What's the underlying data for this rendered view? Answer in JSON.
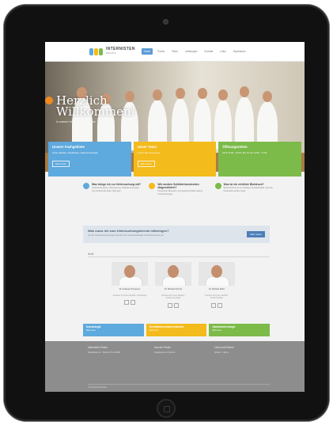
{
  "colors": {
    "box_blue": "#5ea9dd",
    "box_yellow": "#f3bb1c",
    "box_green": "#7cba4a",
    "nav_active": "#5b9bd5",
    "footer": "#8d8d8d"
  },
  "nav": {
    "logo": "INTERNISTEN",
    "logo_sub": "PRAXIS",
    "items": [
      "Home",
      "Praxis",
      "Team",
      "Leistungen",
      "Kontakt",
      "Links",
      "Impressum"
    ]
  },
  "hero": {
    "title_line1": "Herzlich",
    "title_line2": "Willkommen!",
    "subtitle": "in unserer Internistischen Praxis"
  },
  "boxes": [
    {
      "title": "Unsere Fachgebiete",
      "text": "Innere Medizin, Kardiologie, Gastroenterologie",
      "button": "Mehr lesen"
    },
    {
      "title": "Unser Team",
      "text": "Lernen Sie uns kennen",
      "button": "Mehr lesen"
    },
    {
      "title": "Öffnungszeiten",
      "text": "Mo-Fr 8:00 - 12:00 | Mo, Di, Do 14:00 - 17:00",
      "button": ""
    }
  ],
  "features": [
    {
      "title": "Was bringe ich zur Untersuchung mit?",
      "text": "Versichertenkarte, Überweisung, Medikamentenplan und Vorbefunde bitte mitbringen."
    },
    {
      "title": "Wie werden Schilddrüsenknoten diagnostiziert?",
      "text": "Ultraschall, Blutwerte und gegebenenfalls weitere Untersuchungen."
    },
    {
      "title": "Was ist ein erhöhter Blutdruck?",
      "text": "Bluthochdruck ist ein häufiges Krankheitsbild, das früh behandelt werden sollte."
    }
  ],
  "banner": {
    "title": "Was muss ich zum Untersuchungstermin mitbringen?",
    "text": "Für die Untersuchung bringen Sie bitte Ihre Versichertenkarte und Überweisung mit.",
    "button": "Mehr lesen"
  },
  "team": {
    "label": "Ärzte",
    "doctors": [
      {
        "name": "Dr. Andreas Thompson",
        "role": "Facharzt für Innere Medizin, Kardiologie"
      },
      {
        "name": "Dr. Michael Schmitt",
        "role": "Facharzt für Innere Medizin, Gastroenterologie"
      },
      {
        "name": "Dr. Michael Weiß",
        "role": "Facharzt für Innere Medizin, Endokrinologie"
      }
    ]
  },
  "color_row": [
    {
      "title": "Kardiologie",
      "text": "Mehr lesen"
    },
    {
      "title": "Schilddrüsensprechstunde",
      "text": "Mehr lesen"
    },
    {
      "title": "Gastroenterologie",
      "text": "Mehr lesen"
    }
  ],
  "footer": {
    "col1_head": "Internisten-Praxis",
    "col1_text": "Hauptstraße 12 · Telefon 0731 123456",
    "col2_head": "Aus der Praxis",
    "col2_text": "Neuigkeiten und Termine",
    "col3_head": "Links und Partner",
    "col3_text": "Kliniken · Labore",
    "copyright": "© Internistische Praxis"
  }
}
